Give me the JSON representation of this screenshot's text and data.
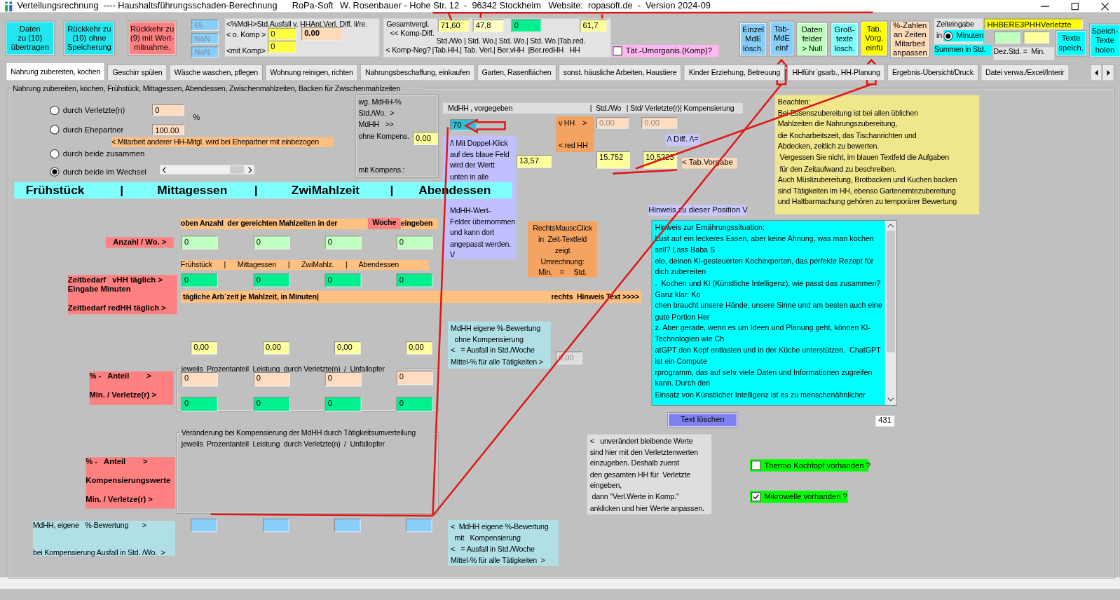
{
  "window": {
    "title": "Verteilungsrechnung  ---- Haushaltsführungsschaden-Berechnung",
    "vendor": "RoPa-Soft",
    "info": "W. Rosenbauer - Hohe Str. 12  -  96342 Stockheim   Website:  ropasoft.de  -  Version 2024-09"
  },
  "toolbar": [
    {
      "kind": "button",
      "text": "Daten\nzu (10)\nübertragen"
    },
    {
      "kind": "button",
      "text": "Rückkehr zu\n(10) ohne\nSpeicherung"
    },
    {
      "kind": "button",
      "text": "Rückkehr zu\n(9) mit Wert-\nmitnahme."
    },
    {
      "kind": "field",
      "value": "65",
      "disabled": true
    },
    {
      "kind": "field",
      "value": "NaN",
      "disabled": true
    },
    {
      "kind": "field",
      "value": "NaN",
      "disabled": true
    },
    {
      "kind": "label",
      "text": "<%MdH>Std.Ausfall v. HHAnt.Verl. Diff. li/re."
    },
    {
      "kind": "label",
      "text": "< o. Komp >"
    },
    {
      "kind": "field",
      "value": "0"
    },
    {
      "kind": "field",
      "value": "0.00"
    },
    {
      "kind": "label",
      "text": "<mit Komp>"
    },
    {
      "kind": "field",
      "value": "0"
    },
    {
      "kind": "label",
      "text": "Gesamtvergl."
    },
    {
      "kind": "label",
      "text": "<< Komp-Diff."
    },
    {
      "kind": "field",
      "value": "71,60"
    },
    {
      "kind": "field",
      "value": "47,8"
    },
    {
      "kind": "field",
      "value": "0"
    },
    {
      "kind": "field",
      "value": "61,7"
    },
    {
      "kind": "label",
      "text": "Std./Wo | Std. Wo.| Std. Wo.| Std. Wo.|Tab.red."
    },
    {
      "kind": "label",
      "text": "< Komp-Neg?"
    },
    {
      "kind": "label",
      "text": "|Tab.HH.| Tab. Verl.| Ber.vHH  |Ber.redHH   HH"
    },
    {
      "kind": "checkbox",
      "text": "Tät.-Umorganis.(Komp)?",
      "checked": false
    },
    {
      "kind": "button",
      "text": "Einzel\nMdE\nlösch."
    },
    {
      "kind": "button",
      "text": "Tab-\nMdE\neinf"
    },
    {
      "kind": "button",
      "text": "Daten\nfelder\n> Null"
    },
    {
      "kind": "button",
      "text": "Groß-\ntexte\nlösch."
    },
    {
      "kind": "button",
      "text": "Tab.\nVorg.\neinfü"
    },
    {
      "kind": "button",
      "text": "%-Zahlen\nan Zeiten\nMitarbeit\nanpassen"
    },
    {
      "kind": "label",
      "text": "Zeiteingabe"
    },
    {
      "kind": "label",
      "text": "in"
    },
    {
      "kind": "radio",
      "text": "Minuten",
      "selected": true
    },
    {
      "kind": "label",
      "text": "Summen in Std."
    },
    {
      "kind": "field",
      "value": "HHBERE3PHHVerletzte"
    },
    {
      "kind": "field"
    },
    {
      "kind": "field"
    },
    {
      "kind": "label",
      "text": "Dez.Std. =  Min."
    },
    {
      "kind": "button",
      "text": "Texte\nspeich."
    },
    {
      "kind": "button",
      "text": "Speich-\nTexte\nholen"
    }
  ],
  "tabs": [
    {
      "label": "Nahrung zubereiten, kochen",
      "selected": true
    },
    {
      "label": "Geschirr spülen",
      "selected": false
    },
    {
      "label": "Wäsche waschen, pflegen",
      "selected": false
    },
    {
      "label": "Wohnung reinigen, richten",
      "selected": false
    },
    {
      "label": "Nahrungsbeschaffung, einkaufen",
      "selected": false
    },
    {
      "label": "Garten, Rasenflächen",
      "selected": false
    },
    {
      "label": "sonst. häusliche Arbeiten, Haustiere",
      "selected": false
    },
    {
      "label": "Kinder Erziehung, Betreuung",
      "selected": false
    },
    {
      "label": "HHführ`gsarb., HH-Planung",
      "selected": false
    },
    {
      "label": "Ergebnis-Übersicht/Druck",
      "selected": false
    },
    {
      "label": "Datei verwa./Excel/Interir",
      "selected": false
    }
  ],
  "form": [
    {
      "kind": "label",
      "text": "Nahrung zubereiten, kochen, Frühstück, Mittagessen, Abendessen, Zwischenmahlzeiten, Backen für Zwischenmahlzeiten"
    },
    {
      "kind": "radio",
      "text": "durch Verletzte(n)",
      "selected": false
    },
    {
      "kind": "field",
      "value": "0"
    },
    {
      "kind": "label",
      "text": "%"
    },
    {
      "kind": "radio",
      "text": "durch Ehepartner",
      "selected": false
    },
    {
      "kind": "field",
      "value": "100.00"
    },
    {
      "kind": "label",
      "text": "< Mitarbeit anderer HH-Mitgl. wird bei Ehepartner mit einbezogen"
    },
    {
      "kind": "radio",
      "text": "durch beide zusammen",
      "selected": false
    },
    {
      "kind": "radio",
      "text": "durch beide im Wechsel",
      "selected": true
    },
    {
      "kind": "label",
      "text": "wg. MdHH-%"
    },
    {
      "kind": "label",
      "text": "Std./Wo.  >"
    },
    {
      "kind": "label",
      "text": "MdHH   >>"
    },
    {
      "kind": "label",
      "text": "ohne Kompens."
    },
    {
      "kind": "field",
      "value": "0,00"
    },
    {
      "kind": "label",
      "text": "mit Kompens.:"
    },
    {
      "kind": "label",
      "text": "MdHH , vorgegeben"
    },
    {
      "kind": "label",
      "text": "|  Std./Wo"
    },
    {
      "kind": "label",
      "text": "| Std/ Verletzte(r)| Kompensierung"
    },
    {
      "kind": "field",
      "value": "70"
    },
    {
      "kind": "label",
      "text": "/\\ Mit Doppel-Klick\nauf des blaue Feld\nwird der Wertt\nunten in alle"
    },
    {
      "kind": "label",
      "text": "MdHH-Wert-\nFelder übernommen\nund kann dort\nangepasst werden.\nV"
    },
    {
      "kind": "label",
      "text": "Frühstück"
    },
    {
      "kind": "label",
      "text": "|"
    },
    {
      "kind": "label",
      "text": "Mittagessen"
    },
    {
      "kind": "label",
      "text": "|"
    },
    {
      "kind": "label",
      "text": "ZwiMahlzeit"
    },
    {
      "kind": "label",
      "text": "|"
    },
    {
      "kind": "label",
      "text": "Abendessen"
    },
    {
      "kind": "field",
      "value": "13,57"
    },
    {
      "kind": "label",
      "text": "v HH    >\n\n< red HH"
    },
    {
      "kind": "field",
      "value": "0.00",
      "disabled": true
    },
    {
      "kind": "field",
      "value": "0.00",
      "disabled": true
    },
    {
      "kind": "label",
      "text": "/\\ Diff. /\\="
    },
    {
      "kind": "field",
      "value": "15.752"
    },
    {
      "kind": "field",
      "value": "10,5223"
    },
    {
      "kind": "label",
      "text": "< Tab.Vorgabe"
    },
    {
      "kind": "label",
      "text": "Beachten:\nBei Essenszubereitung ist bei allen üblichen\nMahlzeiten die Nahrungszubereitung,\ndie Kocharbeitszeit, das Tischanrichten und\nAbdecken, zeitlich zu bewerten.\n Vergessen Sie nicht, im blauen Textfeld die Aufgaben\n für den Zeitaufwand zu beschreiben.\nAuch Müslizubereitung, Brotbacken und Kuchen backen\nsind Tätigkeiten im HH, ebenso Gartenerntezubereitung\nund Haltbarmachung gehören zu temporärer Bewertung"
    },
    {
      "kind": "label",
      "text": "RechtsMauscClick\nin  Zeit-Textfeld\nzeigt\nUmrechnung:\nMin.    =     Std."
    },
    {
      "kind": "label",
      "text": "Hinweis zu dieser Position V"
    },
    {
      "kind": "textarea",
      "value": "Hinweis zur Ernährungssituation:\nLust auf ein leckeres Essen, aber keine Ahnung, was man kochen\nsoll? Lass Baba S\nelo, deinen KI-gesteuerten Kochexperten, das perfekte Rezept für\ndich zubereiten\n.  Kochen und KI (Künstliche Intelligenz), wie passt das zusammen?\nGanz klar: Ko\nchen braucht unsere Hände, unsere Sinne und am besten auch eine\ngute Portion Her\nz. Aber gerade, wenn es um Ideen und Planung geht, können KI-\nTechnologien wie Ch\natGPT den Kopf entlasten und in der Küche unterstützen.  ChatGPT\nist ein Compute\nrprogramm, das auf sehr viele Daten und Informationen zugreifen\nkann. Durch den\nEinsatz von Künstlicher Intelligenz ist es zu menschenähnlicher"
    },
    {
      "kind": "button",
      "text": "Text löschen"
    },
    {
      "kind": "label",
      "text": "431"
    },
    {
      "kind": "label",
      "text": "oben Anzahl  der gereichten Mahlzeiten in der"
    },
    {
      "kind": "label",
      "text": "Woche"
    },
    {
      "kind": "label",
      "text": "eingeben"
    },
    {
      "kind": "label",
      "text": "Anzahl / Wo. >"
    },
    {
      "kind": "field",
      "value": "0"
    },
    {
      "kind": "field",
      "value": "0"
    },
    {
      "kind": "field",
      "value": "0"
    },
    {
      "kind": "field",
      "value": "0"
    },
    {
      "kind": "label",
      "text": "Frühstück      |      Mittagessen      |      ZwiMahlz.      |      Abendessen"
    },
    {
      "kind": "label",
      "text": "Zeitbedarf   vHH täglich >\nEingabe Minuten\n\nZeitbedarf redHH täglich >"
    },
    {
      "kind": "field",
      "value": "0"
    },
    {
      "kind": "field",
      "value": "0"
    },
    {
      "kind": "field",
      "value": "0"
    },
    {
      "kind": "field",
      "value": "0"
    },
    {
      "kind": "label",
      "text": "tägliche Arb`zeit je Mahlzeit, in Minuten|"
    },
    {
      "kind": "label",
      "text": "rechts  Hinweis Text >>>>"
    },
    {
      "kind": "label",
      "text": "MdHH eigene %-Bewertung\n  ohne Kompensierung\n<   = Ausfall in Std./Woche\nMittel-% für alle Tätigkeiten >"
    },
    {
      "kind": "field",
      "value": "0,00",
      "disabled": true
    },
    {
      "kind": "field",
      "value": "0,00"
    },
    {
      "kind": "field",
      "value": "0,00"
    },
    {
      "kind": "field",
      "value": "0,00"
    },
    {
      "kind": "field",
      "value": "0,00"
    },
    {
      "kind": "label",
      "text": "jeweils  Prozentanteil  Leistung  durch Verletzte(n)  /  Unfallopfer"
    },
    {
      "kind": "label",
      "text": "% -   Anteil        >\n\nMin. / Verletze(r) >"
    },
    {
      "kind": "field",
      "value": "0"
    },
    {
      "kind": "field",
      "value": "0"
    },
    {
      "kind": "field",
      "value": "0"
    },
    {
      "kind": "field",
      "value": "0"
    },
    {
      "kind": "field",
      "value": "0"
    },
    {
      "kind": "field",
      "value": "0"
    },
    {
      "kind": "field",
      "value": "0"
    },
    {
      "kind": "field",
      "value": "0"
    },
    {
      "kind": "label",
      "text": "Veränderung bei Kompensierung der MdHH durch Tätigkeitsumverteilung"
    },
    {
      "kind": "label",
      "text": "jeweils  Prozentanteil  Leistung  durch Verletzte(n)  /  Unfallopfer"
    },
    {
      "kind": "label",
      "text": "% -   Anteil        >\n\nKompensierungswerte\n\nMin. / Verletze(r) >"
    },
    {
      "kind": "label",
      "text": "MdHH, eigene   %-Bewertung       >\n\n\nbei Kompensierung Ausfall in Std. /Wo.  >"
    },
    {
      "kind": "field"
    },
    {
      "kind": "field"
    },
    {
      "kind": "field"
    },
    {
      "kind": "field"
    },
    {
      "kind": "label",
      "text": "<  MdHH eigene %-Bewertung\n  mit   Kompensierung\n<   = Ausfall in Std./Woche\nMittel-% für alle Tätigkeiten  >"
    },
    {
      "kind": "label",
      "text": "<   unverändert bleibende Werte\nsind hier mit den Verletztenwerten\neinzugeben. Deshalb zuerst\nden gesamten HH für  Verletzte\neingeben,\n dann \"Verl.Werte in Komp.\"\nanklicken und hier Werte anpassen."
    },
    {
      "kind": "checkbox",
      "text": "Thermo Kochtopf vorhanden ?",
      "checked": false
    },
    {
      "kind": "checkbox",
      "text": "Mikrowelle vorhanden ?",
      "checked": true
    }
  ]
}
